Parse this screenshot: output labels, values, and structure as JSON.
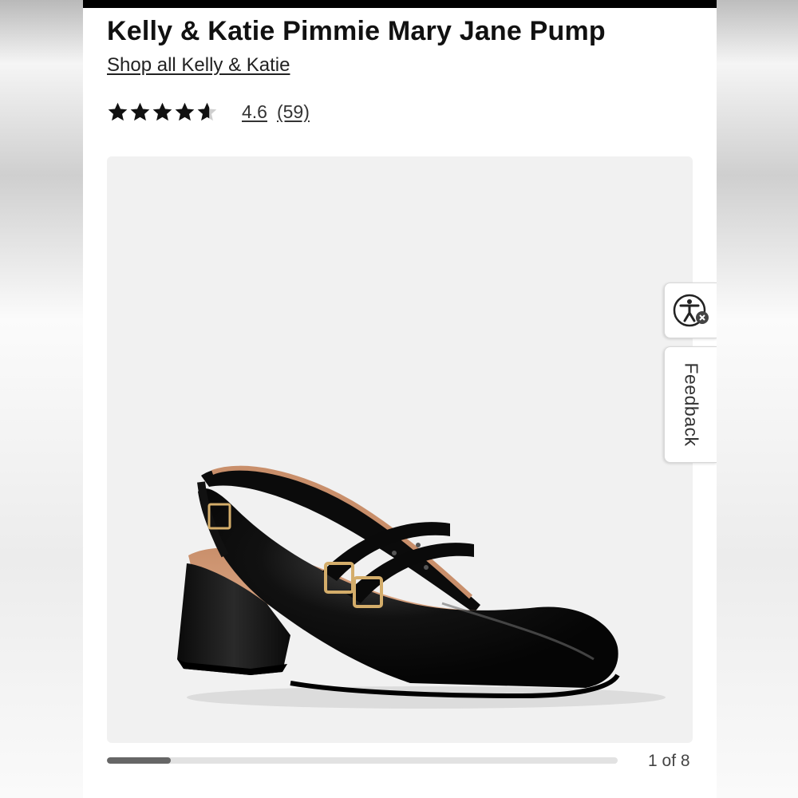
{
  "product": {
    "title": "Kelly & Katie Pimmie Mary Jane Pump",
    "shop_link": "Shop all Kelly & Katie",
    "rating": {
      "stars_value": 4.6,
      "value_text": "4.6",
      "count_text": "(59)"
    }
  },
  "gallery": {
    "counter": "1 of 8",
    "progress": 0.125
  },
  "side_widgets": {
    "accessibility_icon": "accessibility-person-icon",
    "feedback_label": "Feedback"
  },
  "colors": {
    "top_bar": "#000000",
    "image_bg": "#f1f1f1",
    "price_green": "#1b8a3a"
  }
}
